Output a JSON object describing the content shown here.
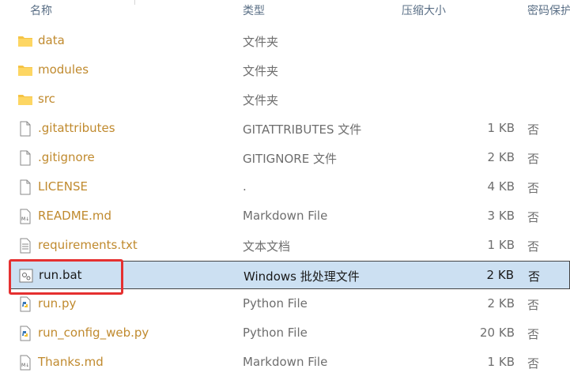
{
  "columns": {
    "name": "名称",
    "type": "类型",
    "compressed_size": "压缩大小",
    "password": "密码保护"
  },
  "rows": [
    {
      "name": "data",
      "type": "文件夹",
      "size": "",
      "password": "",
      "icon": "folder-icon"
    },
    {
      "name": "modules",
      "type": "文件夹",
      "size": "",
      "password": "",
      "icon": "folder-icon"
    },
    {
      "name": "src",
      "type": "文件夹",
      "size": "",
      "password": "",
      "icon": "folder-icon"
    },
    {
      "name": ".gitattributes",
      "type": "GITATTRIBUTES 文件",
      "size": "1 KB",
      "password": "否",
      "icon": "file-icon"
    },
    {
      "name": ".gitignore",
      "type": "GITIGNORE 文件",
      "size": "2 KB",
      "password": "否",
      "icon": "file-icon"
    },
    {
      "name": "LICENSE",
      "type": ".",
      "size": "4 KB",
      "password": "否",
      "icon": "file-icon"
    },
    {
      "name": "README.md",
      "type": "Markdown File",
      "size": "3 KB",
      "password": "否",
      "icon": "markdown-file-icon"
    },
    {
      "name": "requirements.txt",
      "type": "文本文档",
      "size": "1 KB",
      "password": "否",
      "icon": "text-file-icon"
    },
    {
      "name": "run.bat",
      "type": "Windows 批处理文件",
      "size": "2 KB",
      "password": "否",
      "icon": "batch-file-icon",
      "selected": true
    },
    {
      "name": "run.py",
      "type": "Python File",
      "size": "2 KB",
      "password": "否",
      "icon": "python-file-icon"
    },
    {
      "name": "run_config_web.py",
      "type": "Python File",
      "size": "20 KB",
      "password": "否",
      "icon": "python-file-icon"
    },
    {
      "name": "Thanks.md",
      "type": "Markdown File",
      "size": "1 KB",
      "password": "否",
      "icon": "markdown-file-icon"
    }
  ],
  "colors": {
    "selected_row": "#cce0f2",
    "highlight_box": "#e53030",
    "folder": "#f5c344"
  }
}
